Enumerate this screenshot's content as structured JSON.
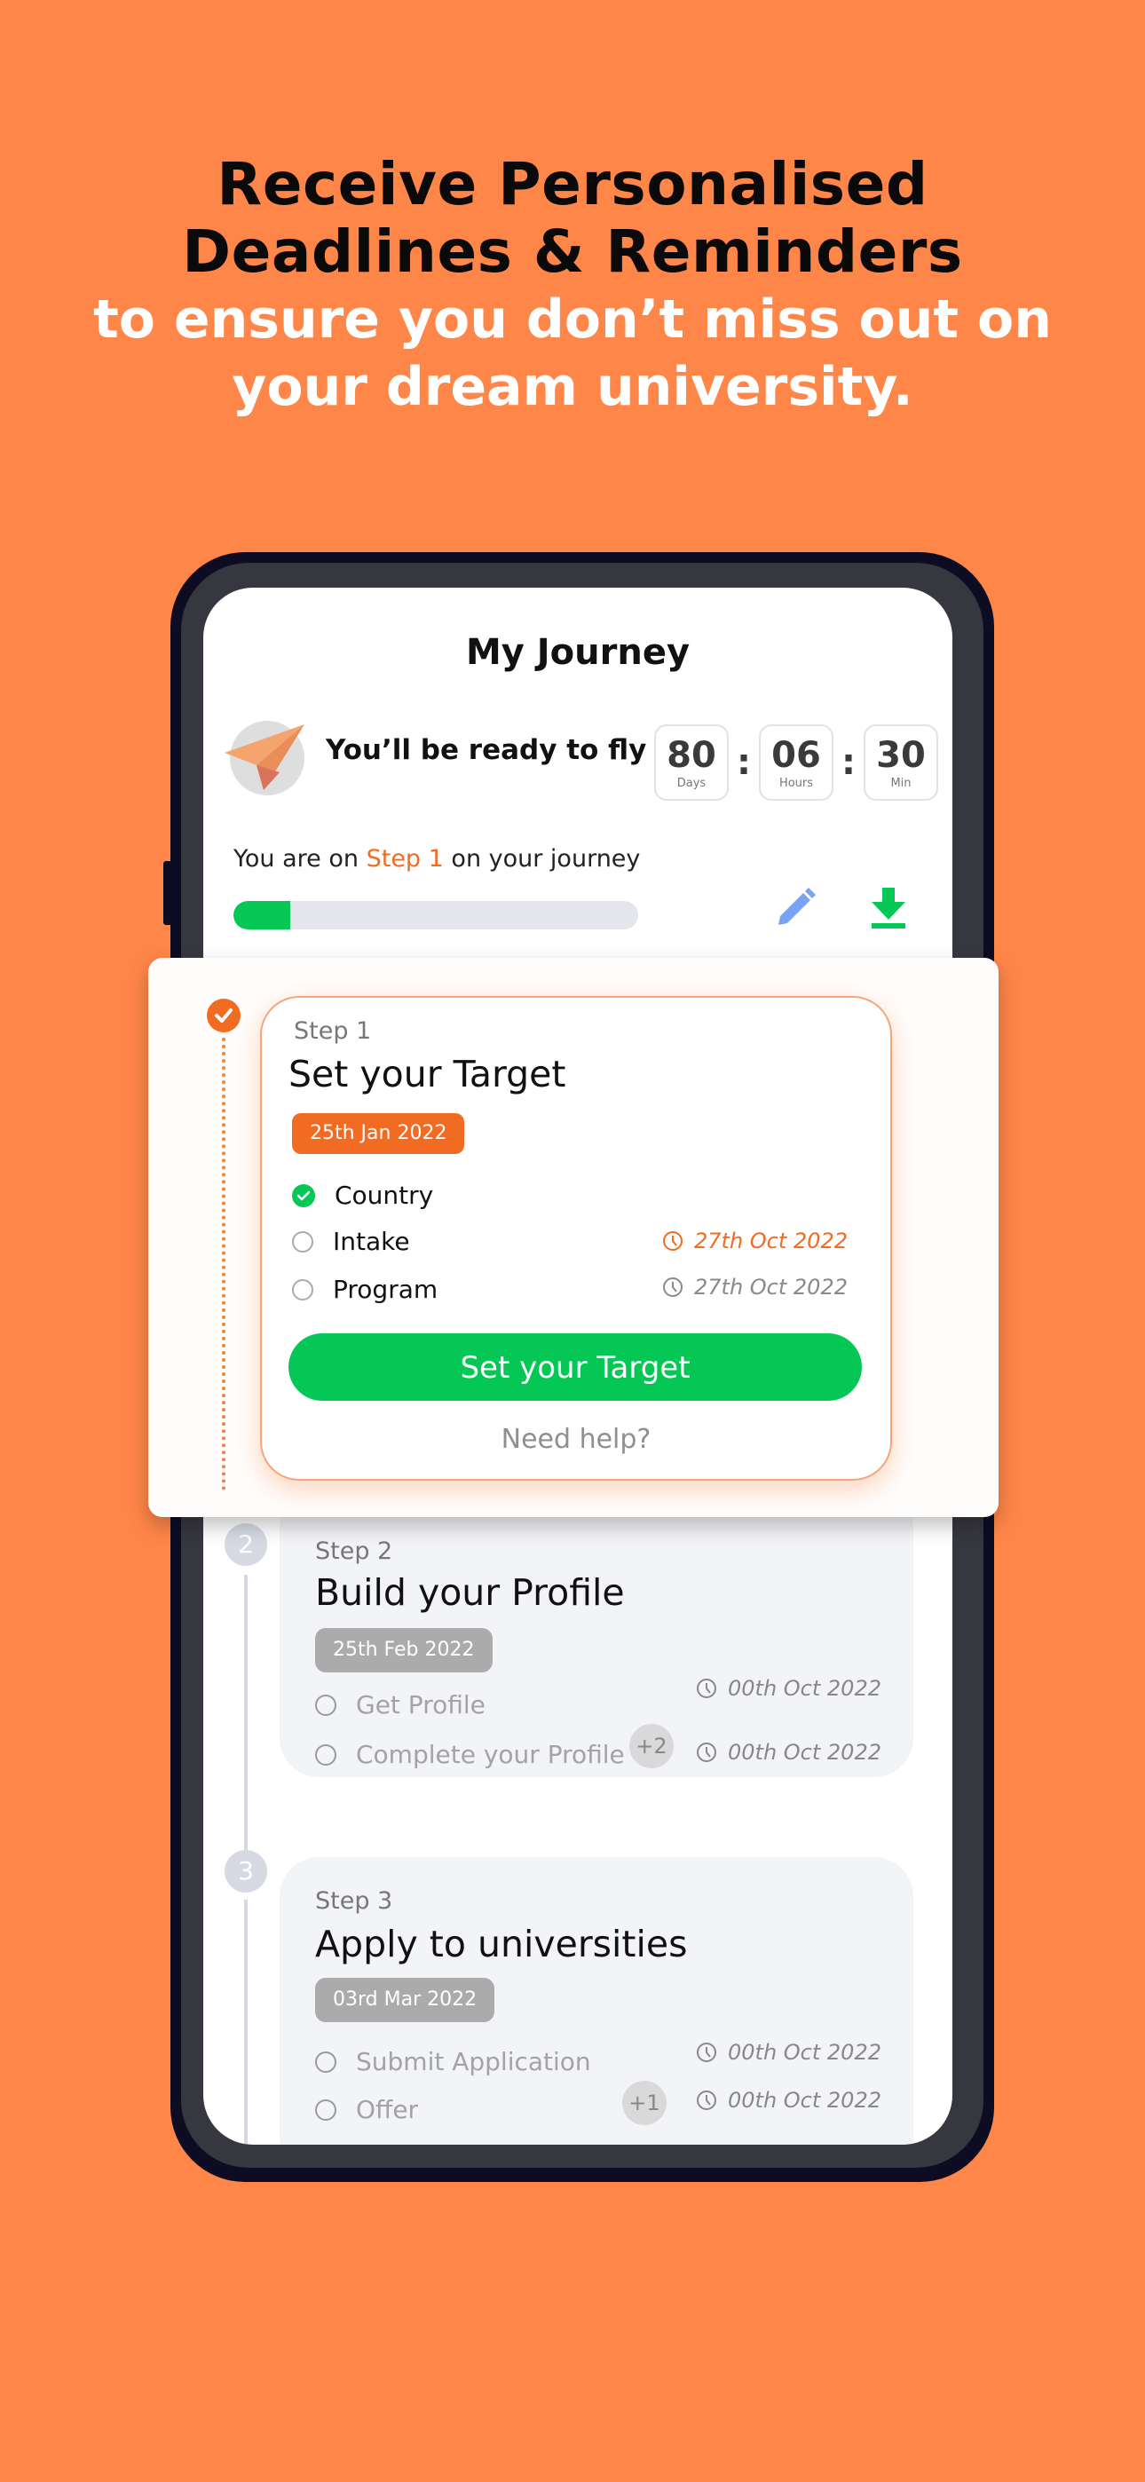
{
  "headline": {
    "line1": "Receive Personalised",
    "line2": "Deadlines & Reminders",
    "sub1": "to ensure you don’t miss out on",
    "sub2": "your dream university."
  },
  "colors": {
    "background": "#FF8649",
    "accent": "#F26B22",
    "success": "#05C755",
    "edit": "#7BA3F5"
  },
  "app": {
    "title": "My Journey",
    "avatar_icon": "paper-plane-icon",
    "ready_text": "You’ll be ready to fly",
    "countdown": [
      {
        "value": "80",
        "label": "Days"
      },
      {
        "value": "06",
        "label": "Hours"
      },
      {
        "value": "30",
        "label": "Min"
      }
    ],
    "countdown_separator": ":",
    "step_status": {
      "prefix": "You are on ",
      "highlight": "Step 1",
      "suffix": " on your journey"
    },
    "progress_percent": 14,
    "actions": [
      {
        "icon": "edit-pencil-icon"
      },
      {
        "icon": "download-icon"
      }
    ]
  },
  "steps": [
    {
      "step_label": "Step 1",
      "number": "1",
      "title": "Set your Target",
      "date": "25th Jan 2022",
      "state": "active",
      "tasks": [
        {
          "label": "Country",
          "done": true,
          "due": ""
        },
        {
          "label": "Intake",
          "done": false,
          "due": "27th Oct 2022",
          "due_urgent": true
        },
        {
          "label": "Program",
          "done": false,
          "due": "27th Oct 2022",
          "due_urgent": false
        }
      ],
      "cta_label": "Set your Target",
      "help_label": "Need help?"
    },
    {
      "step_label": "Step 2",
      "number": "2",
      "title": "Build your Profile",
      "date": "25th Feb 2022",
      "state": "locked",
      "tasks": [
        {
          "label": "Get Profile",
          "done": false,
          "due": "00th Oct 2022"
        },
        {
          "label": "Complete your Profile",
          "done": false,
          "due": "00th Oct 2022"
        }
      ],
      "more_badge": "+2"
    },
    {
      "step_label": "Step 3",
      "number": "3",
      "title": "Apply to universities",
      "date": "03rd Mar 2022",
      "state": "locked",
      "tasks": [
        {
          "label": "Submit Application",
          "done": false,
          "due": "00th Oct 2022"
        },
        {
          "label": "Offer",
          "done": false,
          "due": "00th Oct 2022"
        }
      ],
      "more_badge": "+1"
    }
  ]
}
